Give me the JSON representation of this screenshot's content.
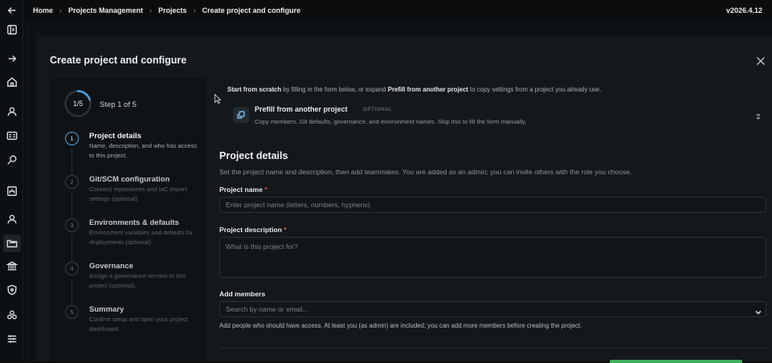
{
  "breadcrumb": {
    "items": [
      "Home",
      "Projects Management",
      "Projects",
      "Create project and configure"
    ],
    "version": "v2026.4.12"
  },
  "rail": {
    "icons": [
      "back-icon",
      "panel-toggle-icon",
      "forward-icon",
      "home-icon",
      "user-icon",
      "id-card-icon",
      "search-icon",
      "org-chart-icon",
      "person-icon",
      "folders-icon",
      "bank-icon",
      "shield-icon",
      "cluster-icon",
      "sliders-icon"
    ],
    "active": "folders-icon"
  },
  "modal": {
    "title": "Create project and configure",
    "progress": {
      "label": "1/5",
      "step_text": "Step 1 of 5",
      "fraction": 0.2
    },
    "steps": [
      {
        "num": "1",
        "title": "Project details",
        "desc": "Name, description, and who has access to this project."
      },
      {
        "num": "2",
        "title": "Git/SCM configuration",
        "desc": "Connect repositories and IaC export settings (optional)."
      },
      {
        "num": "3",
        "title": "Environments & defaults",
        "desc": "Environment variables and defaults for deployments (optional)."
      },
      {
        "num": "4",
        "title": "Governance",
        "desc": "Assign a governance version to this project (optional)."
      },
      {
        "num": "5",
        "title": "Summary",
        "desc": "Confirm setup and open your project dashboard."
      }
    ],
    "intro": {
      "scratch": "Start from scratch",
      "part1": " by filling in the form below, or expand ",
      "prefill": "Prefill from another project",
      "part2": " to copy settings from a project you already use."
    },
    "prefill": {
      "title": "Prefill from another project",
      "optional": "OPTIONAL",
      "subtitle": "Copy members, Git defaults, governance, and environment names. Skip this to fill the form manually."
    },
    "section": {
      "title": "Project details",
      "desc": "Set the project name and description, then add teammates. You are added as an admin; you can invite others with the role you choose."
    },
    "fields": {
      "name_label": "Project name",
      "name_placeholder": "Enter project name (letters, numbers, hyphens)",
      "desc_label": "Project description",
      "desc_placeholder": "What is this project for?",
      "members_label": "Add members",
      "members_placeholder": "Search by name or email...",
      "members_help": "Add people who should have access. At least you (as admin) are included; you can add more members before creating the project.",
      "required_mark": "*"
    }
  },
  "colors": {
    "accent": "#4ea3e6",
    "required": "#e05a4e",
    "primary_button": "#3fae5c"
  }
}
